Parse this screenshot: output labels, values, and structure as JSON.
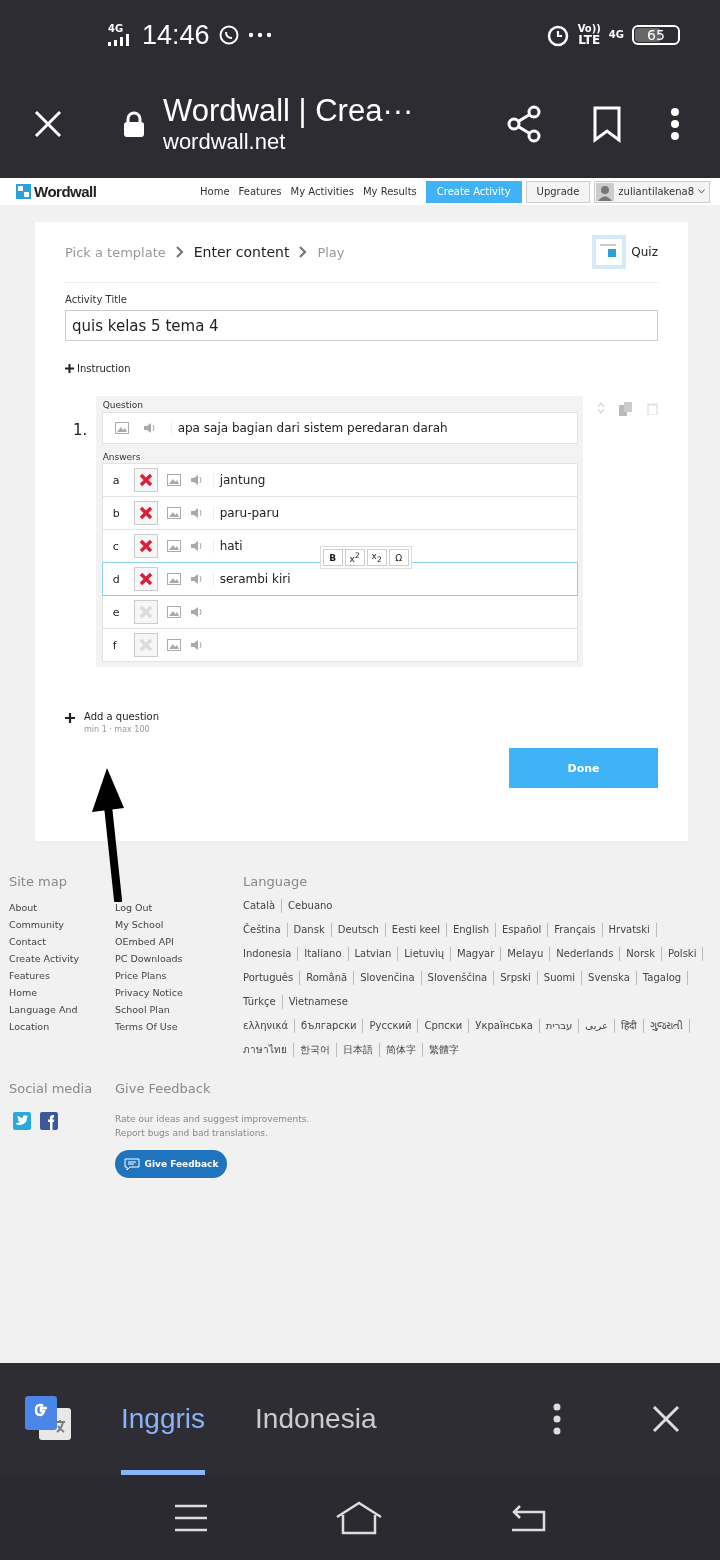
{
  "status_bar": {
    "network": "4G",
    "time": "14:46",
    "volte": "Vo))",
    "lte": "LTE",
    "data": "4G",
    "battery": "65"
  },
  "browser": {
    "title": "Wordwall | Crea···",
    "url": "wordwall.net"
  },
  "site_nav": {
    "logo": "Wordwall",
    "links": [
      "Home",
      "Features",
      "My Activities",
      "My Results"
    ],
    "create": "Create Activity",
    "upgrade": "Upgrade",
    "user": "zuliantilakena8"
  },
  "breadcrumb": [
    {
      "label": "Pick a template",
      "selected": false
    },
    {
      "label": "Enter content",
      "selected": true
    },
    {
      "label": "Play",
      "selected": false
    }
  ],
  "template": "Quiz",
  "activity_title": {
    "label": "Activity Title",
    "value": "quis kelas 5 tema 4"
  },
  "instruction": "Instruction",
  "question": {
    "number": "1.",
    "label": "Question",
    "text": "apa saja bagian dari sistem peredaran darah",
    "answers_label": "Answers",
    "answers": [
      {
        "letter": "a",
        "marked": true,
        "focused": false,
        "text": "jantung"
      },
      {
        "letter": "b",
        "marked": true,
        "focused": false,
        "text": "paru-paru"
      },
      {
        "letter": "c",
        "marked": true,
        "focused": false,
        "text": "hati"
      },
      {
        "letter": "d",
        "marked": true,
        "focused": true,
        "text": "serambi kiri"
      },
      {
        "letter": "e",
        "marked": false,
        "focused": false
      },
      {
        "letter": "f",
        "marked": false,
        "focused": false
      }
    ]
  },
  "format_toolbar": [
    "B",
    "x$^{2}$",
    "x$_{2}$",
    "Ω"
  ],
  "add_question": {
    "label": "Add a question",
    "hint": "min 1 · max 100"
  },
  "done": "Done",
  "footer": {
    "site_map_title": "Site map",
    "site_map_1": [
      "About",
      "Community",
      "Contact",
      "Create Activity",
      "Features",
      "Home",
      "Language And Location"
    ],
    "site_map_2": [
      "Log Out",
      "My School",
      "OEmbed API",
      "PC Downloads",
      "Price Plans",
      "Privacy Notice",
      "School Plan",
      "Terms Of Use"
    ],
    "language_title": "Language",
    "language_groups": [
      [
        "Català",
        "Cebuano"
      ],
      [
        "Čeština",
        "Dansk",
        "Deutsch",
        "Eesti keel",
        "English",
        "Español",
        "Français",
        "Hrvatski",
        "Indonesia",
        "Italiano",
        "Latvian",
        "Lietuvių",
        "Magyar",
        "Melayu",
        "Nederlands",
        "Norsk",
        "Polski",
        "Português",
        "Română",
        "Slovenčina",
        "Slovenščina",
        "Srpski",
        "Suomi",
        "Svenska",
        "Tagalog",
        "Türkçe",
        "Vietnamese"
      ],
      [
        "ελληνικά",
        "български",
        "Русский",
        "Српски",
        "Українська",
        "עברית",
        "عربى",
        "हिंदी",
        "ગુજરાતી",
        "ภาษาไทย",
        "한국어",
        "日本語",
        "简体字",
        "繁體字"
      ]
    ],
    "social_title": "Social media",
    "feedback_title": "Give Feedback",
    "feedback_text": "Rate our ideas and suggest improvements. Report bugs and bad translations.",
    "feedback_button": "Give Feedback"
  },
  "translate_bar": {
    "languages": [
      {
        "label": "Inggris",
        "selected": true
      },
      {
        "label": "Indonesia",
        "selected": false
      }
    ]
  }
}
